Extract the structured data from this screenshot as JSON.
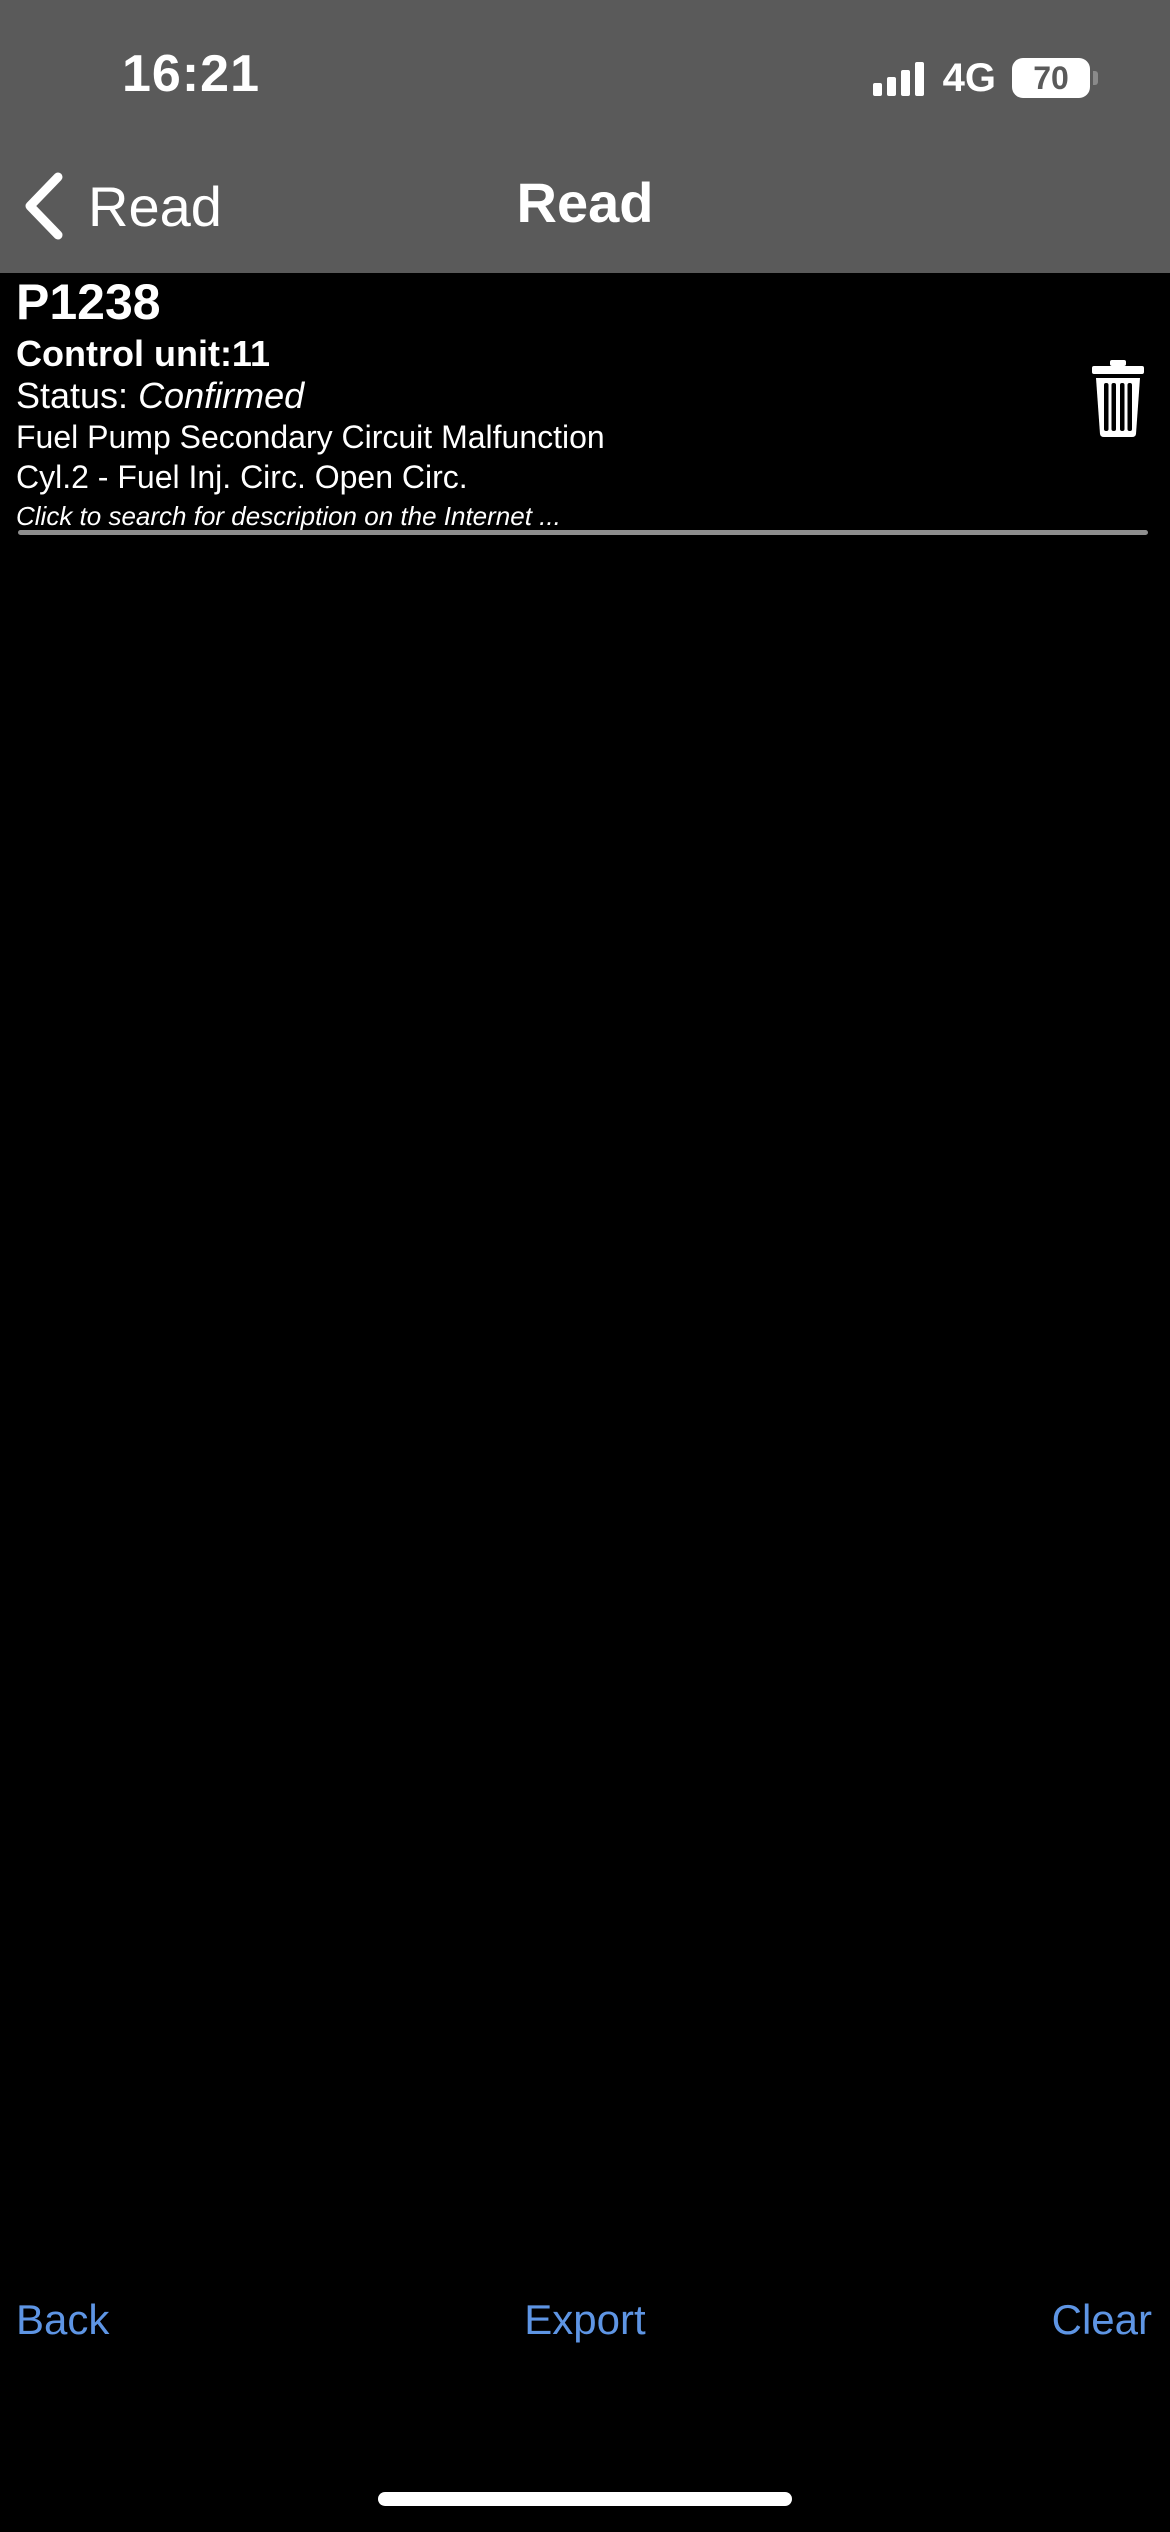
{
  "status_bar": {
    "time": "16:21",
    "network": "4G",
    "battery": "70"
  },
  "nav": {
    "back_label": "Read",
    "title": "Read"
  },
  "fault": {
    "code": "P1238",
    "control_unit": "Control unit:11",
    "status_prefix": "Status: ",
    "status_value": "Confirmed",
    "description": "Fuel Pump Secondary Circuit Malfunction",
    "detail": "Cyl.2 - Fuel Inj. Circ. Open Circ.",
    "hint": "Click to search for description on the Internet ..."
  },
  "toolbar": {
    "back_label": "Back",
    "export_label": "Export",
    "clear_label": "Clear"
  },
  "colors": {
    "header_bg": "#5a5a5a",
    "background": "#000000",
    "accent": "#5e95e4"
  }
}
